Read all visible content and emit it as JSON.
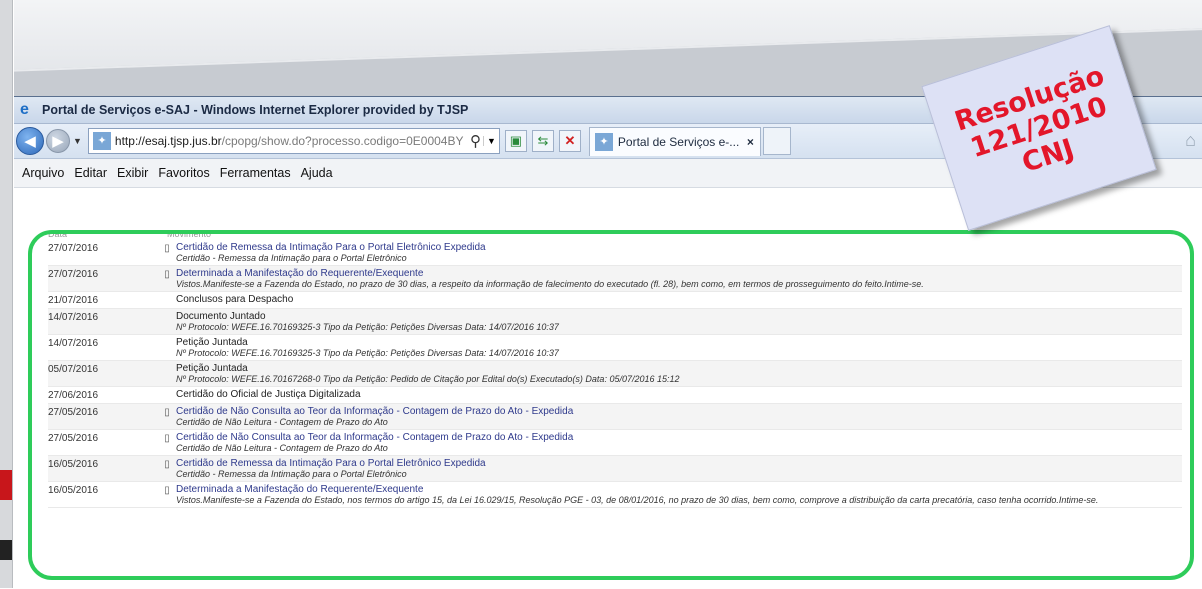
{
  "browser": {
    "title": "Portal de Serviços e-SAJ - Windows Internet Explorer provided by TJSP",
    "url_host": "http://esaj.tjsp.jus.br",
    "url_path": "/cpopg/show.do?processo.codigo=0E0004BY",
    "tab_label": "Portal de Serviços e-...",
    "tab_close": "×"
  },
  "menu": [
    "Arquivo",
    "Editar",
    "Exibir",
    "Favoritos",
    "Ferramentas",
    "Ajuda"
  ],
  "stamp": {
    "line1": "Resolução",
    "line2": "121/2010",
    "line3": "CNJ"
  },
  "table": {
    "header_date": "Data",
    "header_mov": "Movimento"
  },
  "rows": [
    {
      "date": "27/07/2016",
      "title": "Certidão de Remessa da Intimação Para o Portal Eletrônico Expedida",
      "desc": "Certidão - Remessa da Intimação para o Portal Eletrônico",
      "doc": true
    },
    {
      "date": "27/07/2016",
      "title": "Determinada a Manifestação do Requerente/Exequente",
      "desc": "Vistos.Manifeste-se a Fazenda do Estado, no prazo de 30 dias, a respeito da informação de falecimento do executado (fl. 28), bem como, em termos de prosseguimento do feito.Intime-se.",
      "doc": true
    },
    {
      "date": "21/07/2016",
      "title": "Conclusos para Despacho",
      "desc": "",
      "doc": false
    },
    {
      "date": "14/07/2016",
      "title": "Documento Juntado",
      "desc": "Nº Protocolo: WEFE.16.70169325-3 Tipo da Petição: Petições Diversas Data: 14/07/2016 10:37",
      "doc": false
    },
    {
      "date": "14/07/2016",
      "title": "Petição Juntada",
      "desc": "Nº Protocolo: WEFE.16.70169325-3 Tipo da Petição: Petições Diversas Data: 14/07/2016 10:37",
      "doc": false
    },
    {
      "date": "05/07/2016",
      "title": "Petição Juntada",
      "desc": "Nº Protocolo: WEFE.16.70167268-0 Tipo da Petição: Pedido de Citação por Edital do(s) Executado(s) Data: 05/07/2016 15:12",
      "doc": false
    },
    {
      "date": "27/06/2016",
      "title": "Certidão do Oficial de Justiça Digitalizada",
      "desc": "",
      "doc": false
    },
    {
      "date": "27/05/2016",
      "title": "Certidão de Não Consulta ao Teor da Informação - Contagem de Prazo do Ato - Expedida",
      "desc": "Certidão de Não Leitura - Contagem de Prazo do Ato",
      "doc": true
    },
    {
      "date": "27/05/2016",
      "title": "Certidão de Não Consulta ao Teor da Informação - Contagem de Prazo do Ato - Expedida",
      "desc": "Certidão de Não Leitura - Contagem de Prazo do Ato",
      "doc": true
    },
    {
      "date": "16/05/2016",
      "title": "Certidão de Remessa da Intimação Para o Portal Eletrônico Expedida",
      "desc": "Certidão - Remessa da Intimação para o Portal Eletrônico",
      "doc": true
    },
    {
      "date": "16/05/2016",
      "title": "Determinada a Manifestação do Requerente/Exequente",
      "desc": "Vistos.Manifeste-se a Fazenda do Estado, nos termos do artigo 15, da Lei 16.029/15, Resolução PGE - 03, de 08/01/2016, no prazo de 30 dias, bem como, comprove a distribuição da carta precatória, caso tenha ocorrido.Intime-se.",
      "doc": true
    }
  ],
  "colors": {
    "highlight": "#2ecc5a",
    "stamp_text": "#e3162a",
    "link": "#2f3a8c"
  }
}
